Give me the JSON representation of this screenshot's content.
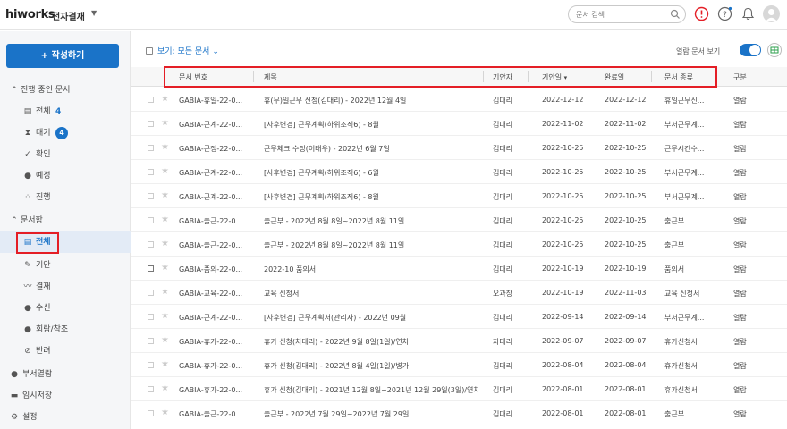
{
  "header": {
    "logo": "hiworks",
    "app_title": "전자결재",
    "search_placeholder": "문서 검색"
  },
  "sidebar": {
    "write_button": "+ 작성하기",
    "in_progress_section": "진행 중인 문서",
    "in_progress_items": [
      {
        "icon": "document-icon",
        "label": "전체",
        "count": "4"
      },
      {
        "icon": "hourglass-icon",
        "label": "대기",
        "count": "4"
      },
      {
        "icon": "check-icon",
        "label": "확인"
      },
      {
        "icon": "clock-icon",
        "label": "예정"
      },
      {
        "icon": "progress-icon",
        "label": "진행"
      }
    ],
    "box_section": "문서함",
    "box_items": [
      {
        "icon": "document-icon",
        "label": "전체"
      },
      {
        "icon": "pencil-icon",
        "label": "기안"
      },
      {
        "icon": "signature-icon",
        "label": "결재"
      },
      {
        "icon": "person-icon",
        "label": "수신"
      },
      {
        "icon": "people-icon",
        "label": "회람/참조"
      },
      {
        "icon": "reject-icon",
        "label": "반려"
      }
    ],
    "bottom_items": [
      {
        "icon": "people-icon",
        "label": "부서열람"
      },
      {
        "icon": "archive-icon",
        "label": "임시저장"
      },
      {
        "icon": "gear-icon",
        "label": "설정"
      }
    ]
  },
  "toolbar": {
    "filter_label": "보기: 모든 문서",
    "toggle_label": "열람 문서 보기",
    "toggle_on": true
  },
  "table": {
    "columns": [
      "문서 번호",
      "제목",
      "기안자",
      "기안일",
      "완료일",
      "문서 종류",
      "구분"
    ],
    "rows": [
      {
        "no": "GABIA-휴일-22-0...",
        "title": "휴(무)일근무 신청(김대리) - 2022년 12월 4일",
        "drafter": "김대리",
        "draft_date": "2022-12-12",
        "done_date": "2022-12-12",
        "type": "휴일근무신...",
        "category": "열람"
      },
      {
        "no": "GABIA-근계-22-0...",
        "title": "[사후변경] 근무계획(하위조직6) - 8월",
        "drafter": "김대리",
        "draft_date": "2022-11-02",
        "done_date": "2022-11-02",
        "type": "부서근무계...",
        "category": "열람"
      },
      {
        "no": "GABIA-근정-22-0...",
        "title": "근무체크 수정(이태우) - 2022년 6월 7일",
        "drafter": "김대리",
        "draft_date": "2022-10-25",
        "done_date": "2022-10-25",
        "type": "근무시간수...",
        "category": "열람"
      },
      {
        "no": "GABIA-근계-22-0...",
        "title": "[사후변경] 근무계획(하위조직6) - 6월",
        "drafter": "김대리",
        "draft_date": "2022-10-25",
        "done_date": "2022-10-25",
        "type": "부서근무계...",
        "category": "열람"
      },
      {
        "no": "GABIA-근계-22-0...",
        "title": "[사후변경] 근무계획(하위조직6) - 8월",
        "drafter": "김대리",
        "draft_date": "2022-10-25",
        "done_date": "2022-10-25",
        "type": "부서근무계...",
        "category": "열람"
      },
      {
        "no": "GABIA-출근-22-0...",
        "title": "출근부 - 2022년 8월 8일~2022년 8월 11일",
        "drafter": "김대리",
        "draft_date": "2022-10-25",
        "done_date": "2022-10-25",
        "type": "출근부",
        "category": "열람"
      },
      {
        "no": "GABIA-출근-22-0...",
        "title": "출근부 - 2022년 8월 8일~2022년 8월 11일",
        "drafter": "김대리",
        "draft_date": "2022-10-25",
        "done_date": "2022-10-25",
        "type": "출근부",
        "category": "열람"
      },
      {
        "no": "GABIA-품의-22-0...",
        "title": "2022-10 품의서",
        "drafter": "김대리",
        "draft_date": "2022-10-19",
        "done_date": "2022-10-19",
        "type": "품의서",
        "category": "열람"
      },
      {
        "no": "GABIA-교육-22-0...",
        "title": "교육 신청서",
        "drafter": "오과장",
        "draft_date": "2022-10-19",
        "done_date": "2022-11-03",
        "type": "교육 신청서",
        "category": "열람"
      },
      {
        "no": "GABIA-근계-22-0...",
        "title": "[사후변경] 근무계획서(관리자) - 2022년 09월",
        "drafter": "김대리",
        "draft_date": "2022-09-14",
        "done_date": "2022-09-14",
        "type": "부서근무계...",
        "category": "열람"
      },
      {
        "no": "GABIA-휴가-22-0...",
        "title": "휴가 신청(차대리) - 2022년 9월 8일(1일)/연차",
        "drafter": "차대리",
        "draft_date": "2022-09-07",
        "done_date": "2022-09-07",
        "type": "휴가신청서",
        "category": "열람"
      },
      {
        "no": "GABIA-휴가-22-0...",
        "title": "휴가 신청(김대리) - 2022년 8월 4일(1일)/병가",
        "drafter": "김대리",
        "draft_date": "2022-08-04",
        "done_date": "2022-08-04",
        "type": "휴가신청서",
        "category": "열람"
      },
      {
        "no": "GABIA-휴가-22-0...",
        "title": "휴가 신청(김대리) - 2021년 12월 8일~2021년 12월 29일(3일)/연차",
        "drafter": "김대리",
        "draft_date": "2022-08-01",
        "done_date": "2022-08-01",
        "type": "휴가신청서",
        "category": "열람"
      },
      {
        "no": "GABIA-출근-22-0...",
        "title": "출근부 - 2022년 7월 29일~2022년 7월 29일",
        "drafter": "김대리",
        "draft_date": "2022-08-01",
        "done_date": "2022-08-01",
        "type": "출근부",
        "category": "열람"
      }
    ]
  },
  "colors": {
    "accent": "#1a73c8",
    "highlight_box": "#e41e26",
    "alert_icon": "#e41e26"
  }
}
